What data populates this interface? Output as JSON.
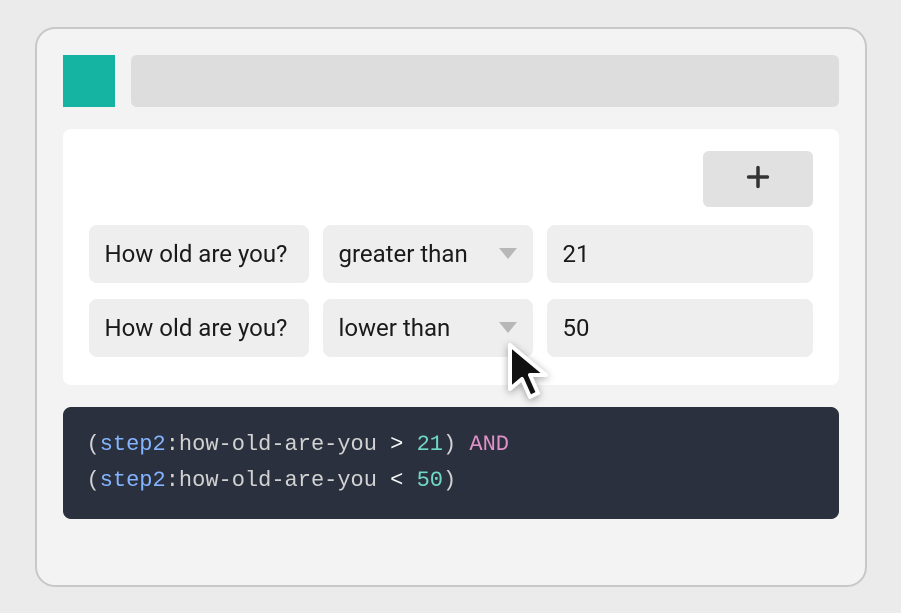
{
  "rules": [
    {
      "question": "How old are you?",
      "operator": "greater than",
      "value": "21"
    },
    {
      "question": "How old are you?",
      "operator": "lower than",
      "value": "50"
    }
  ],
  "code": {
    "line1": {
      "open": "(",
      "step": "step2",
      "colon": ":",
      "slug": "how-old-are-you",
      "op": ">",
      "num": "21",
      "close": ")",
      "and": "AND"
    },
    "line2": {
      "open": "(",
      "step": "step2",
      "colon": ":",
      "slug": "how-old-are-you",
      "op": "<",
      "num": "50",
      "close": ")"
    }
  }
}
